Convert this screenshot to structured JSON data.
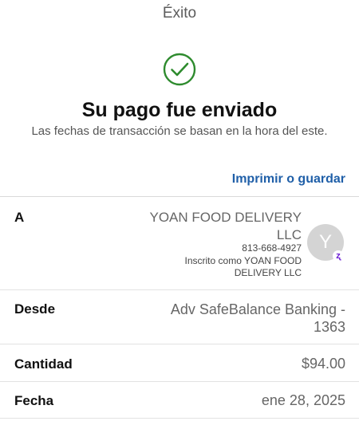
{
  "header": {
    "title": "Éxito"
  },
  "status": {
    "icon": "check-circle-icon",
    "icon_color": "#2e8b2e",
    "headline": "Su pago fue enviado",
    "note": "Las fechas de transacción se basan en la hora del este."
  },
  "actions": {
    "print_label": "Imprimir o guardar",
    "link_color": "#1f5fa8"
  },
  "details": {
    "to_label": "A",
    "recipient_name": "YOAN FOOD DELIVERY LLC",
    "recipient_phone": "813-668-4927",
    "recipient_enrolled": "Inscrito como YOAN FOOD DELIVERY LLC",
    "avatar_initial": "Y",
    "avatar_badge": "zelle-icon",
    "from_label": "Desde",
    "from_value": "Adv SafeBalance Banking - 1363",
    "amount_label": "Cantidad",
    "amount_value": "$94.00",
    "date_label": "Fecha",
    "date_value": "ene 28, 2025"
  }
}
